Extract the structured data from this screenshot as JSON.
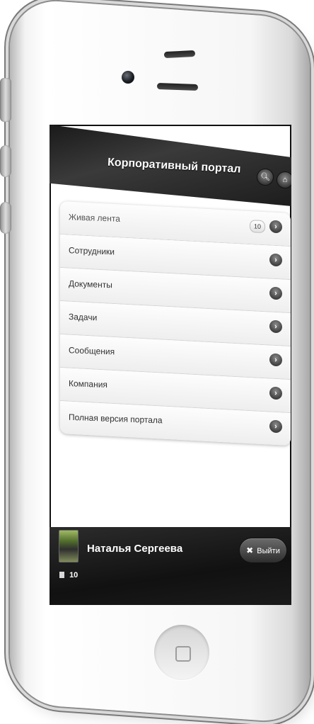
{
  "header": {
    "title": "Корпоративный портал",
    "search_icon": "search-icon",
    "home_icon": "home-icon"
  },
  "menu": {
    "items": [
      {
        "label": "Живая лента",
        "badge": "10"
      },
      {
        "label": "Сотрудники"
      },
      {
        "label": "Документы"
      },
      {
        "label": "Задачи"
      },
      {
        "label": "Сообщения"
      },
      {
        "label": "Компания"
      },
      {
        "label": "Полная версия портала"
      }
    ]
  },
  "footer": {
    "user_name": "Наталья Сергеева",
    "logout_label": "Выйти",
    "logout_icon": "✖",
    "count": "10"
  },
  "colors": {
    "header_bg": "#1a1a1a",
    "footer_bg": "#111111",
    "accent": "#3f3f3f"
  }
}
